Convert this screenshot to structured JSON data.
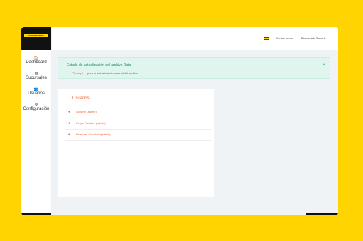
{
  "brand": {
    "logo_text": "InstaMaiimaker"
  },
  "sidebar": {
    "items": [
      {
        "label": "Dashboard",
        "icon": "home-icon",
        "glyph": "🏠"
      },
      {
        "label": "Sucursales",
        "icon": "building-icon",
        "glyph": "▥"
      },
      {
        "label": "Usuarios",
        "icon": "users-icon",
        "glyph": "👥"
      },
      {
        "label": "Configuración",
        "icon": "gear-icon",
        "glyph": "⚙"
      }
    ]
  },
  "header": {
    "language_flag": "spain-flag-icon",
    "service_center": "Service center",
    "welcome": "Bienvenido Soporte"
  },
  "alert": {
    "title": "Estado de actualización del archivo Data",
    "close": "×",
    "bullet": "•",
    "link": "Clic aquí",
    "text": "para la actualización manual del archivo"
  },
  "users_card": {
    "title": "Usuarios",
    "users": [
      {
        "name": "Soporte (admin)"
      },
      {
        "name": "Felipe Ramirez (admin)"
      },
      {
        "name": "Finanzas Chocholiz(admin)"
      }
    ]
  },
  "colors": {
    "background": "#ffd400",
    "accent": "#e8602c",
    "success": "#1e8a6e",
    "dark": "#111111"
  }
}
